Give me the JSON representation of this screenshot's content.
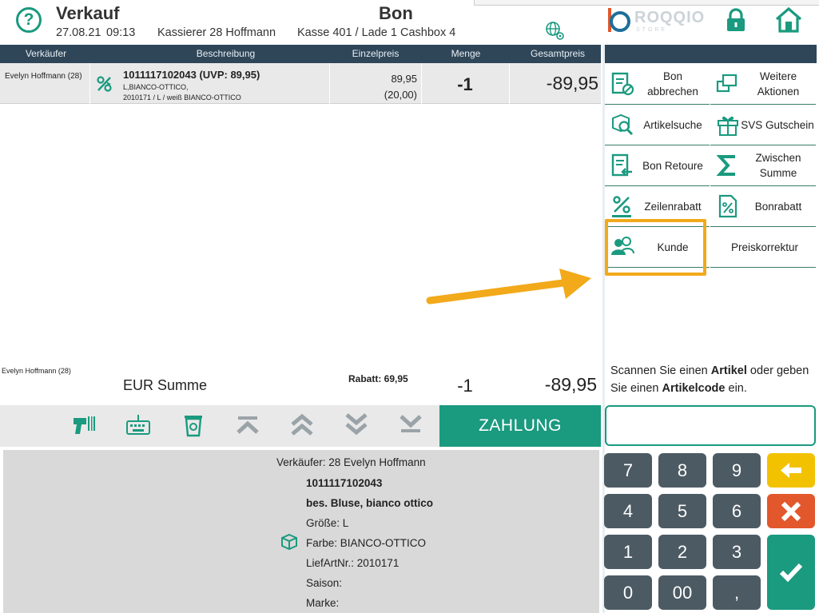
{
  "header": {
    "title": "Verkauf",
    "date": "27.08.21",
    "time": "09:13",
    "cashier": "Kassierer 28 Hoffmann",
    "register": "Kasse 401 / Lade 1 Cashbox 4",
    "document_title": "Bon",
    "brand": "ROQQIO",
    "brand_sub": "STORE"
  },
  "table": {
    "columns": [
      "Verkäufer",
      "Beschreibung",
      "Einzelpreis",
      "Menge",
      "Gesamtpreis"
    ],
    "rows": [
      {
        "seller": "Evelyn Hoffmann (28)",
        "article_line": "1011117102043  (UVP: 89,95)",
        "desc_line1": "L,BIANCO-OTTICO,",
        "desc_line2": "2010171 / L / weiß BIANCO-OTTICO",
        "unit_price": "89,95",
        "unit_price_sub": "(20,00)",
        "quantity": "-1",
        "total": "-89,95"
      }
    ]
  },
  "summary": {
    "seller": "Evelyn Hoffmann (28)",
    "label": "EUR Summe",
    "discount": "Rabatt: 69,95",
    "quantity": "-1",
    "total": "-89,95"
  },
  "toolbar": {
    "pay_label": "ZAHLUNG"
  },
  "detail": {
    "seller": "Verkäufer: 28  Evelyn Hoffmann",
    "article_no": "1011117102043",
    "name": "bes. Bluse, bianco ottico",
    "size": "Größe: L",
    "color": "Farbe: BIANCO-OTTICO",
    "supplier_no": "LiefArtNr.: 2010171",
    "season": "Saison:",
    "brand": "Marke:"
  },
  "actions": [
    {
      "label_l1": "Bon",
      "label_l2": "abbrechen"
    },
    {
      "label_l1": "Weitere",
      "label_l2": "Aktionen"
    },
    {
      "label_l1": "Artikelsuche",
      "label_l2": ""
    },
    {
      "label_l1": "SVS Gutschein",
      "label_l2": ""
    },
    {
      "label_l1": "Bon Retoure",
      "label_l2": ""
    },
    {
      "label_l1": "Zwischen",
      "label_l2": "Summe"
    },
    {
      "label_l1": "Zeilenrabatt",
      "label_l2": ""
    },
    {
      "label_l1": "Bonrabatt",
      "label_l2": ""
    },
    {
      "label_l1": "Kunde",
      "label_l2": ""
    },
    {
      "label_l1": "Preiskorrektur",
      "label_l2": ""
    }
  ],
  "scan_hint": {
    "p1": "Scannen Sie einen ",
    "b1": "Artikel",
    "p2": " oder geben Sie einen ",
    "b2": "Artikelcode",
    "p3": " ein."
  },
  "scan_input": {
    "value": ""
  },
  "keypad": {
    "keys": [
      "7",
      "8",
      "9",
      "4",
      "5",
      "6",
      "1",
      "2",
      "3",
      "0",
      "00",
      ","
    ]
  },
  "colors": {
    "accent": "#1a9a7f",
    "header_bar": "#2f4659",
    "backspace": "#f2c200",
    "cancel": "#e2572b",
    "highlight": "#f2a91a",
    "key": "#4c5a63"
  }
}
